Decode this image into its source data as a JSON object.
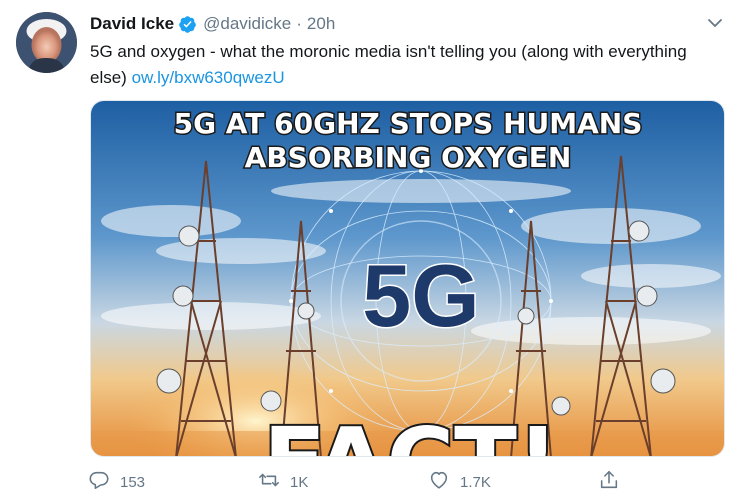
{
  "tweet": {
    "display_name": "David Icke",
    "handle": "@davidicke",
    "separator": "·",
    "time": "20h",
    "text_main": "5G and oxygen - what the moronic media isn't telling you (along with everything else)",
    "link": "ow.ly/bxw630qwezU"
  },
  "media": {
    "headline_line1": "5G AT 60GHZ STOPS HUMANS",
    "headline_line2": "ABSORBING OXYGEN",
    "center_label": "5G",
    "bottom_label": "FACT!"
  },
  "actions": {
    "reply_count": "153",
    "retweet_count": "1K",
    "like_count": "1.7K"
  },
  "colors": {
    "link": "#1b95e0",
    "muted": "#657786",
    "verified": "#1da1f2"
  },
  "icons": {
    "verified": "verified-badge-icon",
    "caret": "chevron-down-icon",
    "reply": "reply-icon",
    "retweet": "retweet-icon",
    "like": "heart-icon",
    "share": "share-icon"
  }
}
